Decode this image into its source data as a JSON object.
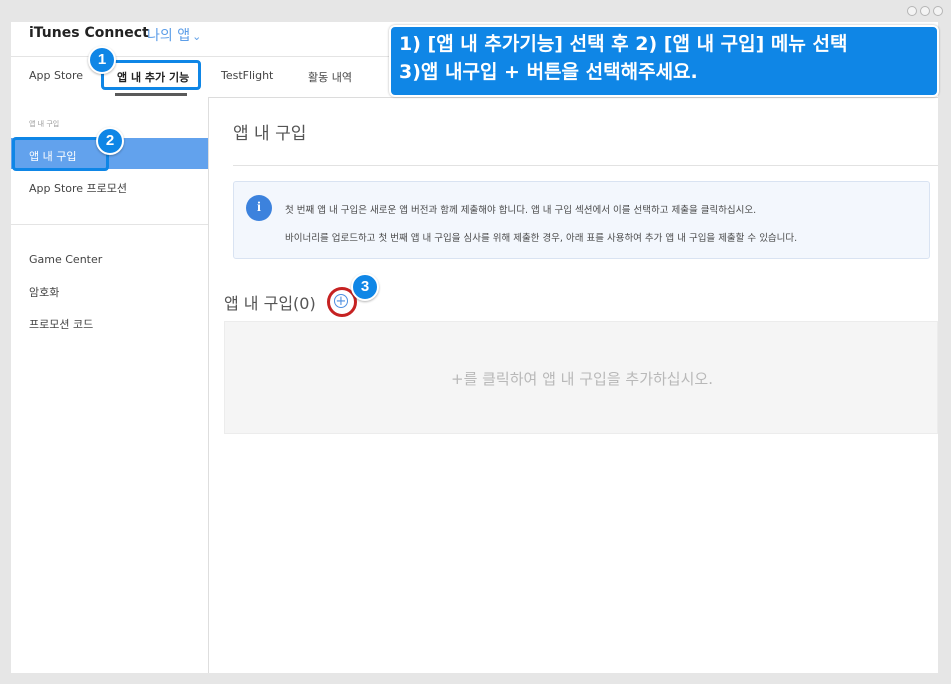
{
  "header": {
    "brand": "iTunes Connect",
    "app_selector": "나의 앱",
    "chevron_icon": "chevron-down-icon"
  },
  "tabs": [
    {
      "label": "App Store"
    },
    {
      "label": "앱 내 추가 기능",
      "active": true
    },
    {
      "label": "TestFlight"
    },
    {
      "label": "활동 내역"
    }
  ],
  "sidebar": {
    "section_header": "앱 내 구입",
    "items": [
      {
        "label": "앱 내 구입",
        "active": true
      },
      {
        "label": "App Store 프로모션"
      },
      {
        "label": "Game Center"
      },
      {
        "label": "암호화"
      },
      {
        "label": "프로모션 코드"
      }
    ]
  },
  "main": {
    "title": "앱 내 구입",
    "info_icon": "i",
    "info_lines": [
      "첫 번째 앱 내 구입은 새로운 앱 버전과 함께 제출해야 합니다. 앱 내 구입 섹션에서 이를 선택하고 제출을 클릭하십시오.",
      "바이너리를 업로드하고 첫 번째 앱 내 구입을 심사를 위해 제출한 경우, 아래 표를 사용하여 추가 앱 내 구입을 제출할 수 있습니다."
    ],
    "iap_heading": "앱 내 구입(0)",
    "add_symbol": "+",
    "empty_message": "+를 클릭하여 앱 내 구입을 추가하십시오."
  },
  "annotations": {
    "callout_line1": "1) [앱 내 추가기능] 선택 후 2) [앱 내 구입] 메뉴 선택",
    "callout_line2": "3)앱 내구입 + 버튼을 선택해주세요.",
    "badges": [
      "1",
      "2",
      "3"
    ],
    "accent_color": "#0f86e6",
    "ring_color": "#c62222"
  }
}
